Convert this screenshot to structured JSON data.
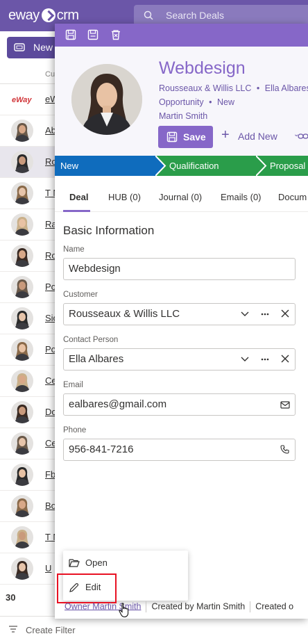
{
  "app": {
    "logo_left": "eway",
    "logo_right": "crm",
    "search_placeholder": "Search Deals",
    "new_label": "New",
    "column_header": "Cu",
    "list_rows": [
      {
        "label": "eW",
        "type": "brand",
        "brand": "eWay"
      },
      {
        "label": "Ab",
        "type": "person"
      },
      {
        "label": "Ro",
        "type": "person",
        "selected": true
      },
      {
        "label": "T N",
        "type": "person"
      },
      {
        "label": "Ra",
        "type": "person"
      },
      {
        "label": "Ro",
        "type": "person"
      },
      {
        "label": "Po",
        "type": "person"
      },
      {
        "label": "Sio",
        "type": "person"
      },
      {
        "label": "Po",
        "type": "person"
      },
      {
        "label": "Ce",
        "type": "person"
      },
      {
        "label": "Do",
        "type": "person"
      },
      {
        "label": "Ce",
        "type": "person"
      },
      {
        "label": "Fb",
        "type": "person"
      },
      {
        "label": "Bo",
        "type": "person"
      },
      {
        "label": "T N",
        "type": "person"
      },
      {
        "label": "U",
        "type": "person"
      }
    ],
    "record_count": "30",
    "create_filter": "Create Filter"
  },
  "deal": {
    "title": "Webdesign",
    "customer_line": "Rousseaux & Willis LLC",
    "contact_line": "Ella Albares",
    "bullet": "•",
    "type": "Opportunity",
    "status": "New",
    "owner_name": "Martin Smith",
    "save_label": "Save",
    "add_new_label": "Add New",
    "stages": [
      {
        "label": "New",
        "color": "#0f6cbd"
      },
      {
        "label": "Qualification",
        "color": "#2a9d4a"
      },
      {
        "label": "Proposal",
        "color": "#2a9d4a"
      }
    ],
    "tabs": [
      "Deal",
      "HUB (0)",
      "Journal (0)",
      "Emails (0)",
      "Docum"
    ],
    "section_title": "Basic Information",
    "fields": {
      "name_label": "Name",
      "name_value": "Webdesign",
      "customer_label": "Customer",
      "customer_value": "Rousseaux & Willis LLC",
      "contact_label": "Contact Person",
      "contact_value": "Ella Albares",
      "email_label": "Email",
      "email_value": "ealbares@gmail.com",
      "phone_label": "Phone",
      "phone_value": "956-841-7216"
    },
    "context_menu": {
      "open_label": "Open",
      "edit_label": "Edit"
    },
    "footer": {
      "owner": "Owner Martin Smith",
      "created_by": "Created by Martin Smith",
      "created": "Created o"
    }
  },
  "colors": {
    "brand": "#6b56a8",
    "accent": "#8667c8",
    "highlight": "#e81123"
  }
}
